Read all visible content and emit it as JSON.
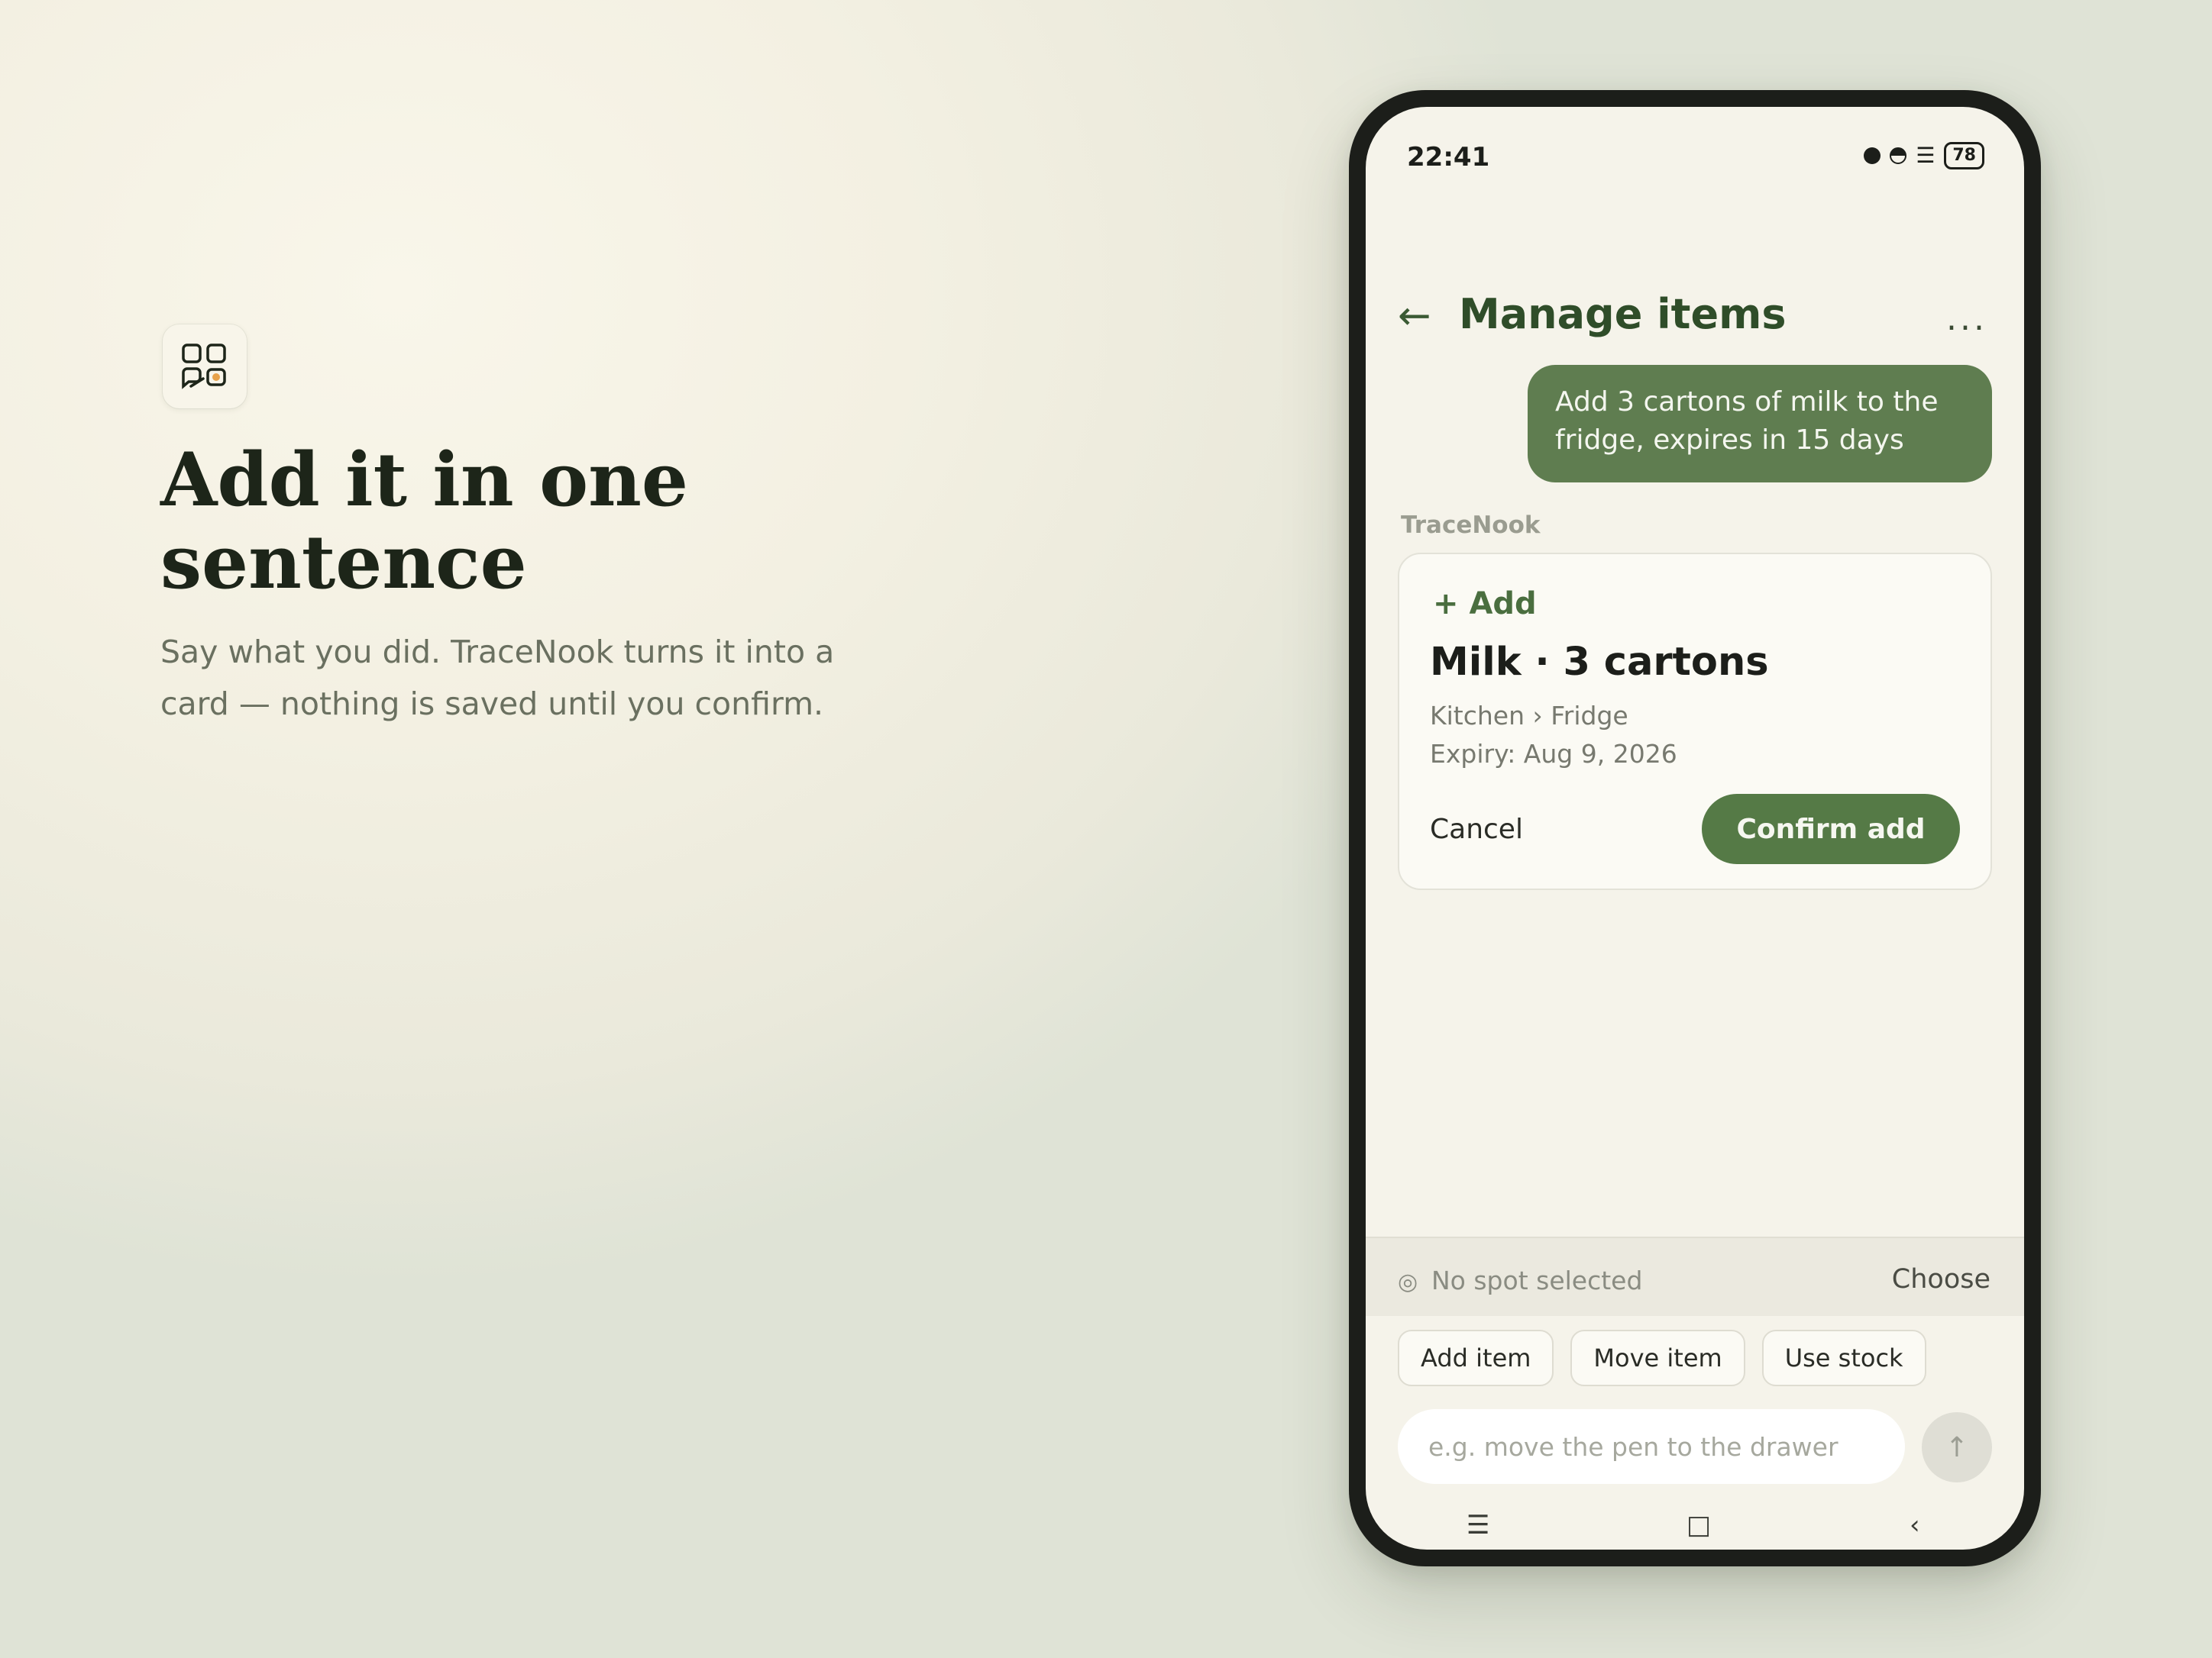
{
  "promo": {
    "headline_line1": "Add it in one",
    "headline_line2": "sentence",
    "subtitle": "Say what you did. TraceNook turns it into a card — nothing is saved until you confirm.",
    "app_icon": "chat-grid-app-icon"
  },
  "status_bar": {
    "time": "22:41",
    "battery": "78",
    "signal_glyph": "☰"
  },
  "header": {
    "back_glyph": "←",
    "title": "Manage items",
    "more_glyph": "..."
  },
  "chat": {
    "user_message": "Add 3 cartons of milk to the fridge, expires in 15 days",
    "assistant_name": "TraceNook",
    "card": {
      "action": "+ Add",
      "title": "Milk · 3 cartons",
      "location": "Kitchen › Fridge",
      "expiry": "Expiry: Aug 9, 2026",
      "cancel_label": "Cancel",
      "confirm_label": "Confirm add"
    }
  },
  "spot": {
    "icon_glyph": "◎",
    "text": "No spot selected",
    "choose_label": "Choose"
  },
  "chips": [
    {
      "label": "Add item"
    },
    {
      "label": "Move item"
    },
    {
      "label": "Use stock"
    }
  ],
  "composer": {
    "placeholder": "e.g. move the pen to the drawer",
    "send_glyph": "↑"
  },
  "nav": {
    "menu_glyph": "☰",
    "home_glyph": "□",
    "back_glyph": "‹"
  },
  "colors": {
    "brand_green": "#557a46",
    "title_green": "#2f4d29",
    "bubble_green": "#5f7d50",
    "accent_orange": "#e8a24a"
  }
}
